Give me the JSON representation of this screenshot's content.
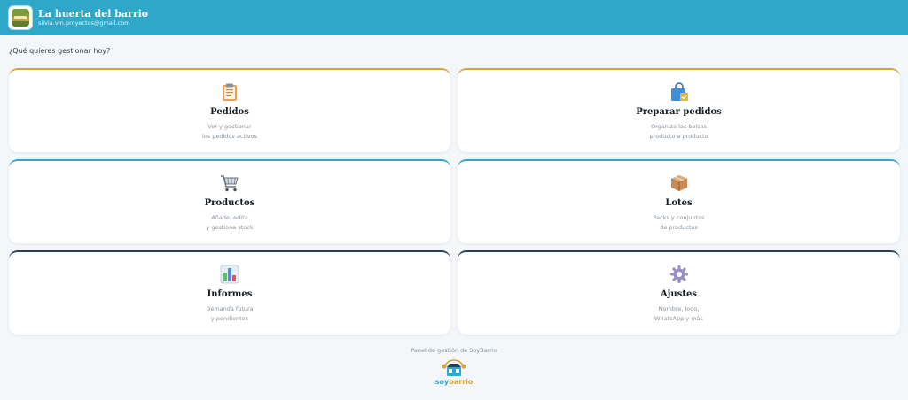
{
  "header": {
    "title": "La huerta del barrio",
    "email": "silvia.vm.proyectos@gmail.com",
    "background": "#2ea7c8"
  },
  "prompt": "¿Qué quieres gestionar hoy?",
  "cards": [
    {
      "title": "Pedidos",
      "desc1": "Ver y gestionar",
      "desc2": "los pedidos activos",
      "icon": "clipboard-icon",
      "accent": "#d6a43c"
    },
    {
      "title": "Preparar pedidos",
      "desc1": "Organiza las bolsas",
      "desc2": "producto a producto",
      "icon": "shopping-bag-icon",
      "accent": "#d6a43c"
    },
    {
      "title": "Productos",
      "desc1": "Añade, edita",
      "desc2": "y gestiona stock",
      "icon": "shopping-cart-icon",
      "accent": "#2ea7c8"
    },
    {
      "title": "Lotes",
      "desc1": "Packs y conjuntos",
      "desc2": "de productos",
      "icon": "package-icon",
      "accent": "#2ea7c8"
    },
    {
      "title": "Informes",
      "desc1": "Demanda futura",
      "desc2": "y pendientes",
      "icon": "bar-chart-icon",
      "accent": "#27405a"
    },
    {
      "title": "Ajustes",
      "desc1": "Nombre, logo,",
      "desc2": "WhatsApp y más",
      "icon": "gear-icon",
      "accent": "#27405a"
    }
  ],
  "footer": {
    "text": "Panel de gestión de SoyBarrio",
    "logo_soy": "soy",
    "logo_barrio": "barrio"
  }
}
